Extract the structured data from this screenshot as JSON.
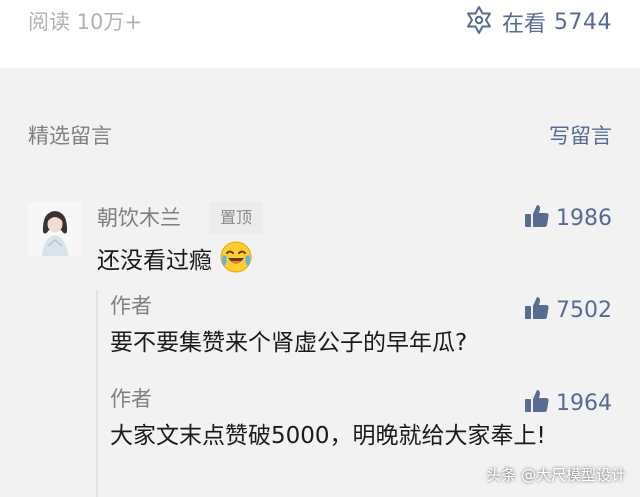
{
  "top": {
    "read_label": "阅读 10万+",
    "looking_label": "在看",
    "looking_count": "5744"
  },
  "section": {
    "title": "精选留言",
    "write_label": "写留言"
  },
  "comment": {
    "nickname": "朝饮木兰",
    "pin_badge": "置顶",
    "like_count": "1986",
    "text": "还没看过瘾"
  },
  "replies": [
    {
      "author": "作者",
      "like_count": "7502",
      "text": "要不要集赞来个肾虚公子的早年瓜?"
    },
    {
      "author": "作者",
      "like_count": "1964",
      "text": "大家文末点赞破5000，明晚就给大家奉上!"
    }
  ],
  "watermark": "头条 @大尺模型设计",
  "colors": {
    "link": "#576b95",
    "muted": "#808080",
    "text": "#1a1a1a",
    "background": "#f2f2f2"
  },
  "icons": [
    "looking-icon",
    "thumbs-up-icon",
    "laughing-crying-emoji"
  ]
}
